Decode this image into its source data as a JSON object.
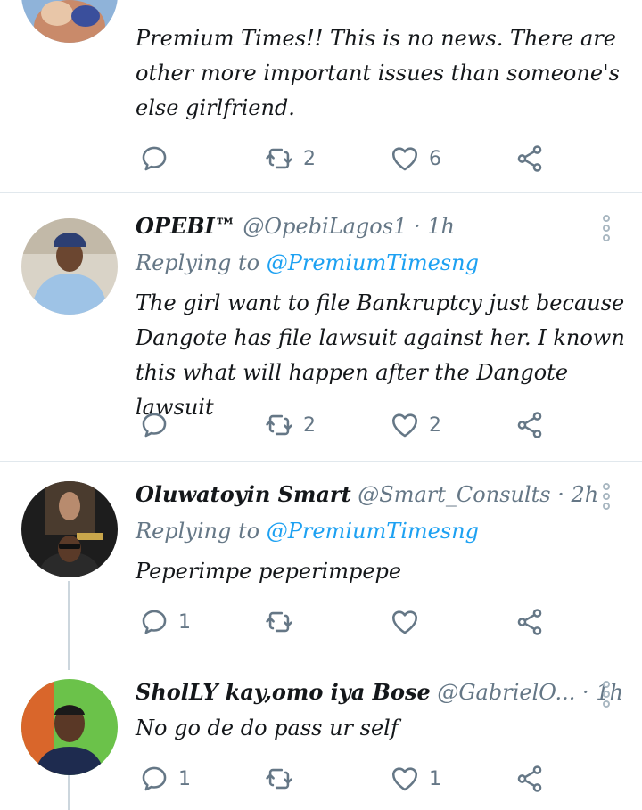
{
  "colors": {
    "accent": "#1da1f2",
    "muted": "#657786",
    "divider": "#e1e8ed",
    "thread_line": "#ccd6dd"
  },
  "tweets": [
    {
      "text": "Premium Times!! This is no news. There are other more important issues than someone's else girlfriend.",
      "actions": {
        "reply": "",
        "retweet": "2",
        "like": "6"
      }
    },
    {
      "name": "OPEBI™",
      "handle": "@OpebiLagos1",
      "dot": "·",
      "time": "1h",
      "reply_prefix": "Replying to",
      "reply_handle": "@PremiumTimesng",
      "text": "The girl want to file Bankruptcy just because Dangote has file lawsuit against her. I known this what will happen after the Dangote lawsuit",
      "actions": {
        "reply": "",
        "retweet": "2",
        "like": "2"
      }
    },
    {
      "name": "Oluwatoyin Smart",
      "handle": "@Smart_Consults",
      "dot": "·",
      "time": "2h",
      "reply_prefix": "Replying to",
      "reply_handle": "@PremiumTimesng",
      "text": "Peperimpe peperimpepe",
      "actions": {
        "reply": "1",
        "retweet": "",
        "like": ""
      }
    },
    {
      "name": "SholLY kay,omo iya Bose",
      "handle": "@GabrielO...",
      "dot": "·",
      "time": "1h",
      "text": "No go de do pass ur self",
      "actions": {
        "reply": "1",
        "retweet": "",
        "like": "1"
      }
    }
  ],
  "icons": {
    "reply": "reply-icon",
    "retweet": "retweet-icon",
    "like": "heart-icon",
    "share": "share-icon",
    "more": "more-options-icon"
  }
}
